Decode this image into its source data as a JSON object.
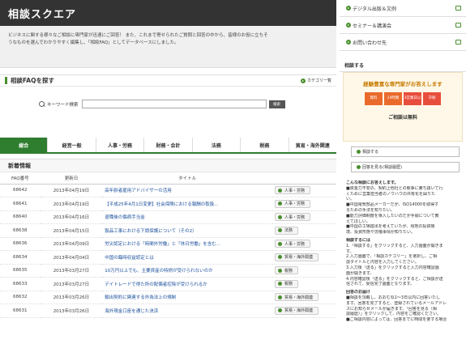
{
  "header": {
    "title": "相談スクエア"
  },
  "intro": [
    "ビジネスに関する様々なご相談に専門家が迅速にご回答！ また、これまで寄せられたご質問と回答の中から、皆様のお役に立ちそ",
    "うなものを選んでわかりやすく編集し、「相談FAQ」としてデータベースにしました。"
  ],
  "faq_search": {
    "heading": "相談FAQを探す",
    "category_link": "カテゴリ一覧",
    "keyword_label": "キーワード検索",
    "search_button": "検索"
  },
  "tabs": [
    "総合",
    "経営一般",
    "人事・労務",
    "財務・会計",
    "法務",
    "税務",
    "貿易・海外関連"
  ],
  "news": {
    "heading": "新着情報",
    "columns": [
      "FAQ番号",
      "更新日",
      "タイトル"
    ],
    "rows": [
      {
        "num": "68642",
        "date": "2013年04月19日",
        "title": "高年齢者雇用アドバイザーの活用",
        "cat": "人事・労務"
      },
      {
        "num": "68641",
        "date": "2013年04月19日",
        "title": "【平成25年4月1日変更】社会保険における報酬の取扱...",
        "cat": "人事・労務"
      },
      {
        "num": "68640",
        "date": "2013年04月16日",
        "title": "退職後の傷病手当金",
        "cat": "人事・労務"
      },
      {
        "num": "68638",
        "date": "2013年04月15日",
        "title": "製品工事における下請保護について（その2）",
        "cat": "法務"
      },
      {
        "num": "68636",
        "date": "2013年04月09日",
        "title": "労災認定における「時間外労働」と「休日労働」を含む...",
        "cat": "人事・労務"
      },
      {
        "num": "68634",
        "date": "2013年04月04日",
        "title": "中国の臨時収益認定とは",
        "cat": "貿易・海外関連"
      },
      {
        "num": "68635",
        "date": "2013年03月27日",
        "title": "10万円以上でも、主要資産の特例が受けられないのか",
        "cat": "税務"
      },
      {
        "num": "68633",
        "date": "2013年03月27日",
        "title": "デイトレードで得た所の配偶者控除が受けられるか",
        "cat": "税務"
      },
      {
        "num": "68632",
        "date": "2013年03月26日",
        "title": "輸出契約に関連する外為法上の規制",
        "cat": "貿易・海外関連"
      },
      {
        "num": "68631",
        "date": "2013年03月26日",
        "title": "海外現金口座を通じた決済",
        "cat": "貿易・海外関連"
      }
    ]
  },
  "right": {
    "links": [
      "デジタル出版＆文例",
      "セミナー＆講演会",
      "お問い合わせ先"
    ],
    "consult_heading": "相談する",
    "consult_caption": "経験豊富な専門家がお答えします",
    "consult_tags": [
      "無料",
      "24時間",
      "3営業日以内",
      "守秘"
    ],
    "consult_free": "ご相談は無料",
    "btn_consult": "相談する",
    "btn_history": "回答を見る(相談履歴)",
    "notes_title1": "こんな相談にお答えします。",
    "notes1": [
      "■資金力不安の、契約上他社との競争に勝ち抜いて行",
      "くために営業担当者のノウハウの共有化を図りた",
      "い。",
      "■中国電気部品メーカーだが、ISO14000を取得す",
      "るための手法を知りたい。",
      "■能力評価制度を導入したいのだが手順について教",
      "えてほしい。",
      "■中国の工場進出を考えていたが、現地の投資環",
      "境、投資形態や労働事情が知りたい。"
    ],
    "notes_title2": "相談するには",
    "notes2": [
      "1.「相談する」をクリックすると、入力画面が開きま",
      "す。",
      "2.入力画面で、「相談カテゴリー」を選択し、ご相",
      "談タイトルと内容を入力してください。",
      "3.入力後「送る」をクリックすると入力内容確認画",
      "面が開きます。",
      "4.内容確認後「送る」をクリックすると、ご相談が送",
      "信されて、受信完了画面となります。"
    ],
    "notes_title3": "回答のお届け",
    "notes3": [
      "■相談を頂戴し、おおむね1～3日以内に回答いたし",
      "ます。回答を完了すると、登録されているメールアドレ",
      "スにお知らせメールが届きます。「回答を見る（相",
      "談履歴）」をクリックして、内容をご確認ください。",
      "■ご相談内容によっては、回答までに時間を要する場合"
    ]
  },
  "colors": {
    "accent": "#2f7d2f",
    "header_bg": "#333333",
    "link": "#1a4f9c",
    "tag_orange": "#e96a2c"
  }
}
